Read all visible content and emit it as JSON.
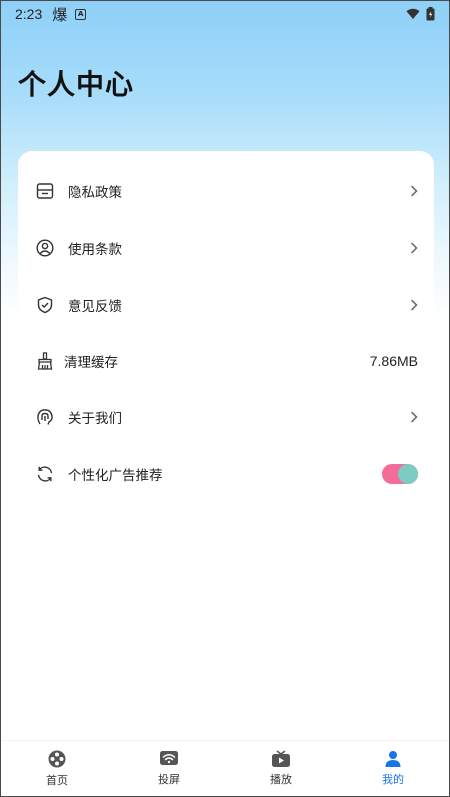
{
  "status_bar": {
    "time": "2:23",
    "app_glyph": "爆",
    "badge": "A"
  },
  "header": {
    "title": "个人中心"
  },
  "menu": {
    "items": [
      {
        "label": "隐私政策",
        "icon": "privacy-icon",
        "right": "chevron"
      },
      {
        "label": "使用条款",
        "icon": "user-terms-icon",
        "right": "chevron"
      },
      {
        "label": "意见反馈",
        "icon": "shield-feedback-icon",
        "right": "chevron"
      },
      {
        "label": "清理缓存",
        "icon": "brush-icon",
        "value": "7.86MB"
      },
      {
        "label": "关于我们",
        "icon": "about-icon",
        "right": "chevron"
      },
      {
        "label": "个性化广告推荐",
        "icon": "refresh-icon",
        "toggle": true
      }
    ]
  },
  "tabbar": {
    "tabs": [
      {
        "label": "首页",
        "icon": "film-reel-icon",
        "active": false
      },
      {
        "label": "投屏",
        "icon": "cast-icon",
        "active": false
      },
      {
        "label": "播放",
        "icon": "tv-play-icon",
        "active": false
      },
      {
        "label": "我的",
        "icon": "person-icon",
        "active": true
      }
    ]
  },
  "colors": {
    "accent": "#1a73e8",
    "toggle_track": "#f56b9a",
    "toggle_knob": "#7ecbc3",
    "header_gradient_top": "#8ed0f8"
  }
}
